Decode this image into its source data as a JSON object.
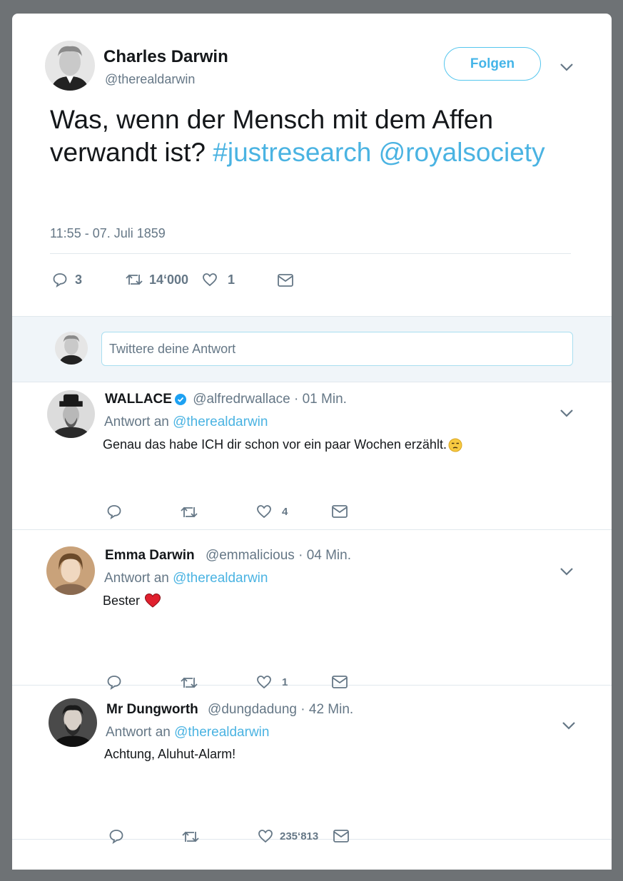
{
  "main": {
    "author_name": "Charles Darwin",
    "author_handle": "@therealdarwin",
    "follow_label": "Folgen",
    "text_plain": "Was, wenn der Mensch mit dem Affen verwandt ist?",
    "hashtag": "#justresearch",
    "mention": "@royalsociety",
    "timestamp": "11:55 - 07. Juli 1859",
    "replies": "3",
    "retweets": "14‘000",
    "likes": "1"
  },
  "reply_box": {
    "placeholder": "Twittere deine Antwort"
  },
  "replies": [
    {
      "name": "WALLACE",
      "verified": true,
      "handle": "@alfredrwallace · 01 Min.",
      "reply_to_label": "Antwort an",
      "reply_to": "@therealdarwin",
      "text": "Genau das habe ICH dir schon vor ein paar Wochen erzählt.",
      "emoji": "unamused-face",
      "likes": "4"
    },
    {
      "name": "Emma Darwin",
      "verified": false,
      "handle": "@emmalicious · 04 Min.",
      "reply_to_label": "Antwort an",
      "reply_to": "@therealdarwin",
      "text": "Bester",
      "emoji": "red-heart",
      "likes": "1"
    },
    {
      "name": "Mr Dungworth",
      "verified": false,
      "handle": "@dungdadung · 42 Min.",
      "reply_to_label": "Antwort an",
      "reply_to": "@therealdarwin",
      "text": "Achtung, Aluhut-Alarm!",
      "likes": "235‘813"
    }
  ],
  "colors": {
    "link": "#4ab3e2",
    "follow_border": "#55c6ee",
    "muted": "#657786",
    "verified": "#1da1f2"
  }
}
